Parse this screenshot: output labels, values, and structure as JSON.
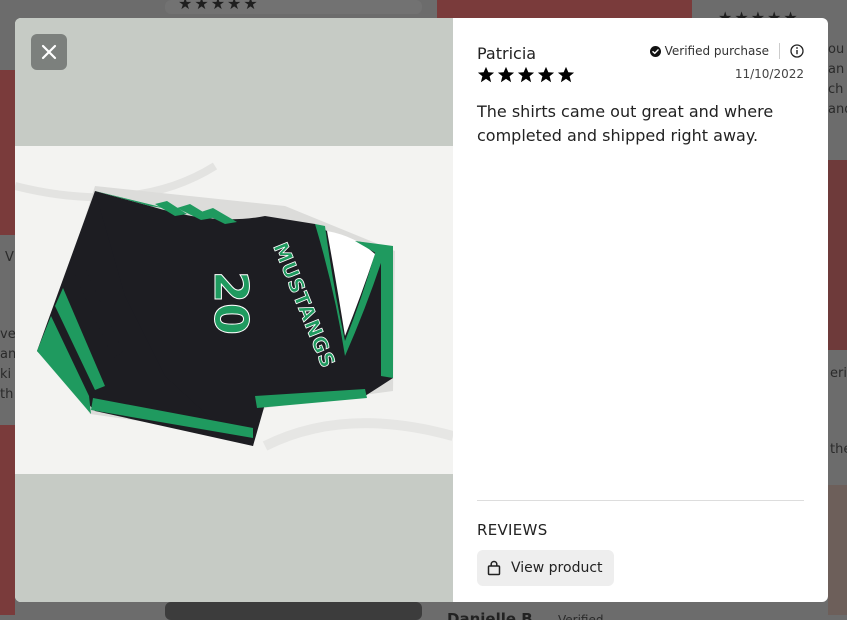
{
  "background": {
    "partial_name": "Danielle B.",
    "partial_verified": "Verified"
  },
  "modal": {
    "close_icon": "close-icon",
    "photo": {
      "jersey_text": "MUSTANGS",
      "jersey_number": "20",
      "colors": {
        "jersey": "#1d1d22",
        "trim": "#1f9a5f"
      }
    },
    "review": {
      "reviewer": "Patricia",
      "verified_label": "Verified purchase",
      "rating": 5,
      "date": "11/10/2022",
      "body": "The shirts came out great and where completed and shipped right away."
    },
    "footer": {
      "reviews_label": "REVIEWS",
      "view_product_label": "View product"
    }
  },
  "colors": {
    "media_bg": "#c6cbc5",
    "close_bg": "#7c807d",
    "star": "#000000"
  }
}
